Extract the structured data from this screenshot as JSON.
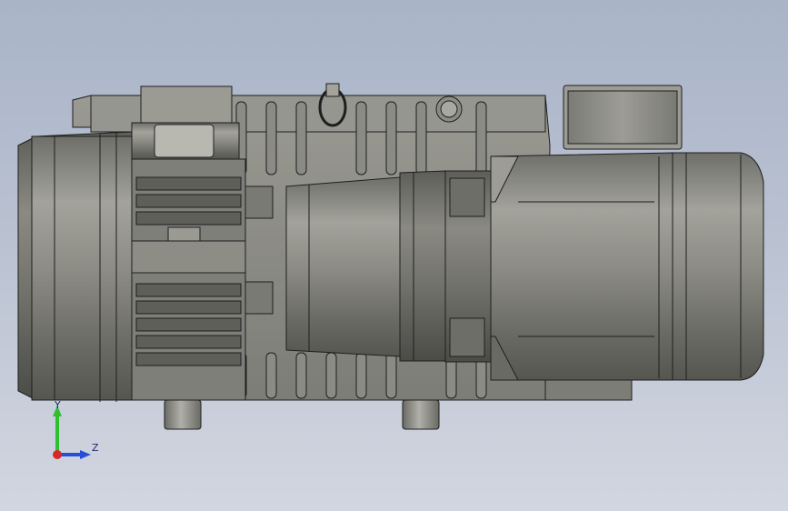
{
  "view": {
    "background_top": "#a9b4c8",
    "background_bottom": "#d2d6e0",
    "model_face_color": "#8e8e87",
    "model_edge_color": "#1e1e1e"
  },
  "model": {
    "subject": "rotary-vane-vacuum-pump-with-motor"
  },
  "triad": {
    "y_label": "Y",
    "z_label": "Z",
    "y_color": "#2fbf2f",
    "z_color": "#2a4fd6",
    "x_color": "#d62a2a"
  }
}
